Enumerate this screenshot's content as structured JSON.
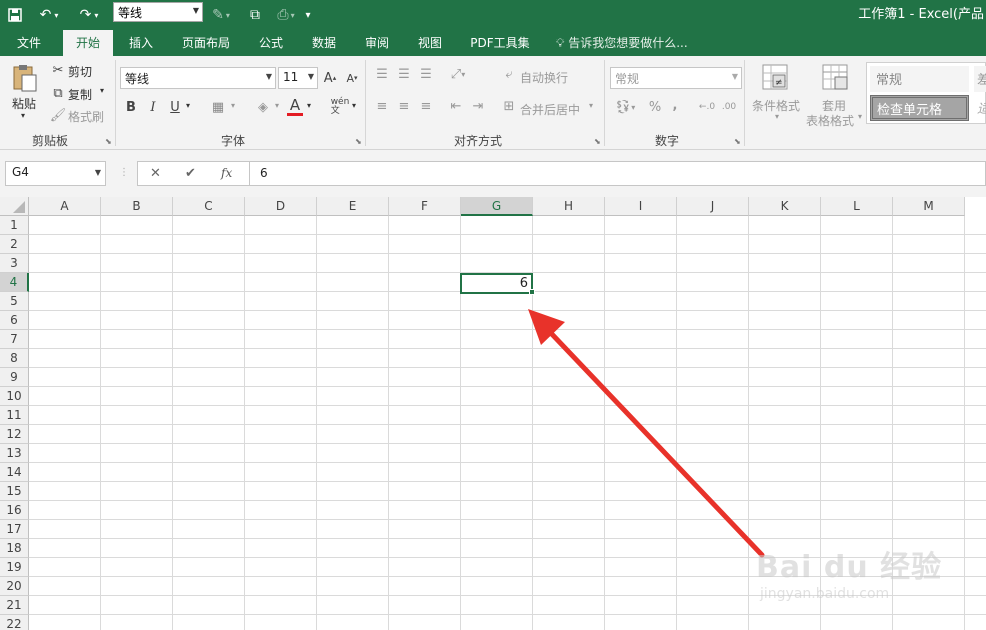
{
  "window": {
    "title": "工作簿1 - Excel(产品"
  },
  "quick_access": {
    "font_name": "等线",
    "icons": [
      "save-icon",
      "undo-icon",
      "redo-icon",
      "format-painter-icon",
      "copy-icon",
      "customize-icon"
    ]
  },
  "tabs": [
    {
      "label": "文件"
    },
    {
      "label": "开始"
    },
    {
      "label": "插入"
    },
    {
      "label": "页面布局"
    },
    {
      "label": "公式"
    },
    {
      "label": "数据"
    },
    {
      "label": "审阅"
    },
    {
      "label": "视图"
    },
    {
      "label": "PDF工具集"
    }
  ],
  "tell_me": "告诉我您想要做什么...",
  "ribbon": {
    "clipboard": {
      "paste": "粘贴",
      "cut": "剪切",
      "copy": "复制",
      "format_painter": "格式刷",
      "label": "剪贴板"
    },
    "font": {
      "name": "等线",
      "size": "11",
      "bold": "B",
      "italic": "I",
      "underline": "U",
      "font_color": "A",
      "label": "字体"
    },
    "alignment": {
      "wrap": "自动换行",
      "merge": "合并后居中",
      "label": "对齐方式"
    },
    "number": {
      "format": "常规",
      "percent": "%",
      "comma": ",",
      "label": "数字"
    },
    "styles": {
      "conditional": "条件格式",
      "table_format_1": "套用",
      "table_format_2": "表格格式",
      "normal": "常规",
      "check_cell": "检查单元格",
      "cut_text_1": "差",
      "cut_text_2": "适"
    }
  },
  "formula_bar": {
    "name_box": "G4",
    "cancel": "✕",
    "confirm": "✔",
    "fx": "fx",
    "value": "6"
  },
  "sheet": {
    "columns": [
      "A",
      "B",
      "C",
      "D",
      "E",
      "F",
      "G",
      "H",
      "I",
      "J",
      "K",
      "L",
      "M"
    ],
    "rows": [
      "1",
      "2",
      "3",
      "4",
      "5",
      "6",
      "7",
      "8",
      "9",
      "10",
      "11",
      "12",
      "13",
      "14",
      "15",
      "16",
      "17",
      "18",
      "19",
      "20",
      "21",
      "22"
    ],
    "active_cell": {
      "ref": "G4",
      "value": "6"
    }
  },
  "watermark": {
    "logo": "Bai du 经验",
    "url": "jingyan.baidu.com"
  },
  "colors": {
    "accent": "#217346",
    "arrow": "#e8322a"
  }
}
